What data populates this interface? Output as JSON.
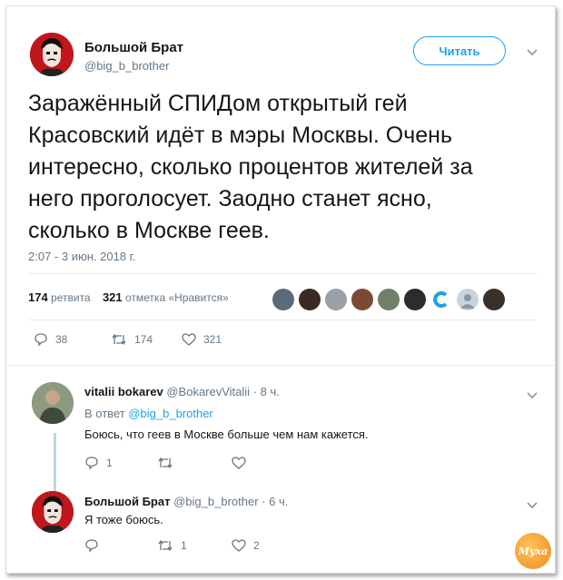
{
  "tweet": {
    "author_name": "Большой Брат",
    "author_handle": "@big_b_brother",
    "follow_label": "Читать",
    "text": "Заражённый СПИДом открытый гей\nКрасовский идёт в мэры Москвы. Очень\nинтересно, сколько процентов жителей за\nнего проголосует. Заодно станет ясно,\nсколько в Москве геев.",
    "timestamp": "2:07 - 3 июн. 2018 г.",
    "retweets_count": "174",
    "retweets_label": "ретвита",
    "likes_count": "321",
    "likes_label": "отметка «Нравится»",
    "actions": {
      "replies": "38",
      "retweets": "174",
      "likes": "321"
    }
  },
  "replies": [
    {
      "author_name": "vitalii bokarev",
      "author_handle": "@BokarevVitalii",
      "time": "· 8 ч.",
      "in_reply_prefix": "В ответ",
      "in_reply_handle": "@big_b_brother",
      "text": "Боюсь, что геев в Москве больше чем нам кажется.",
      "actions": {
        "replies": "1",
        "retweets": "",
        "likes": ""
      }
    },
    {
      "author_name": "Большой Брат",
      "author_handle": "@big_b_brother",
      "time": "· 6 ч.",
      "text": "Я тоже боюсь.",
      "actions": {
        "replies": "",
        "retweets": "1",
        "likes": "2"
      }
    }
  ],
  "watermark": "Муха",
  "colors": {
    "accent": "#1da1f2",
    "muted": "#657786",
    "text": "#14171a",
    "avatar_red": "#c0161c",
    "thread_line": "#c4d5e0"
  },
  "icons": [
    "chevron-down-icon",
    "reply-icon",
    "retweet-icon",
    "like-icon"
  ]
}
